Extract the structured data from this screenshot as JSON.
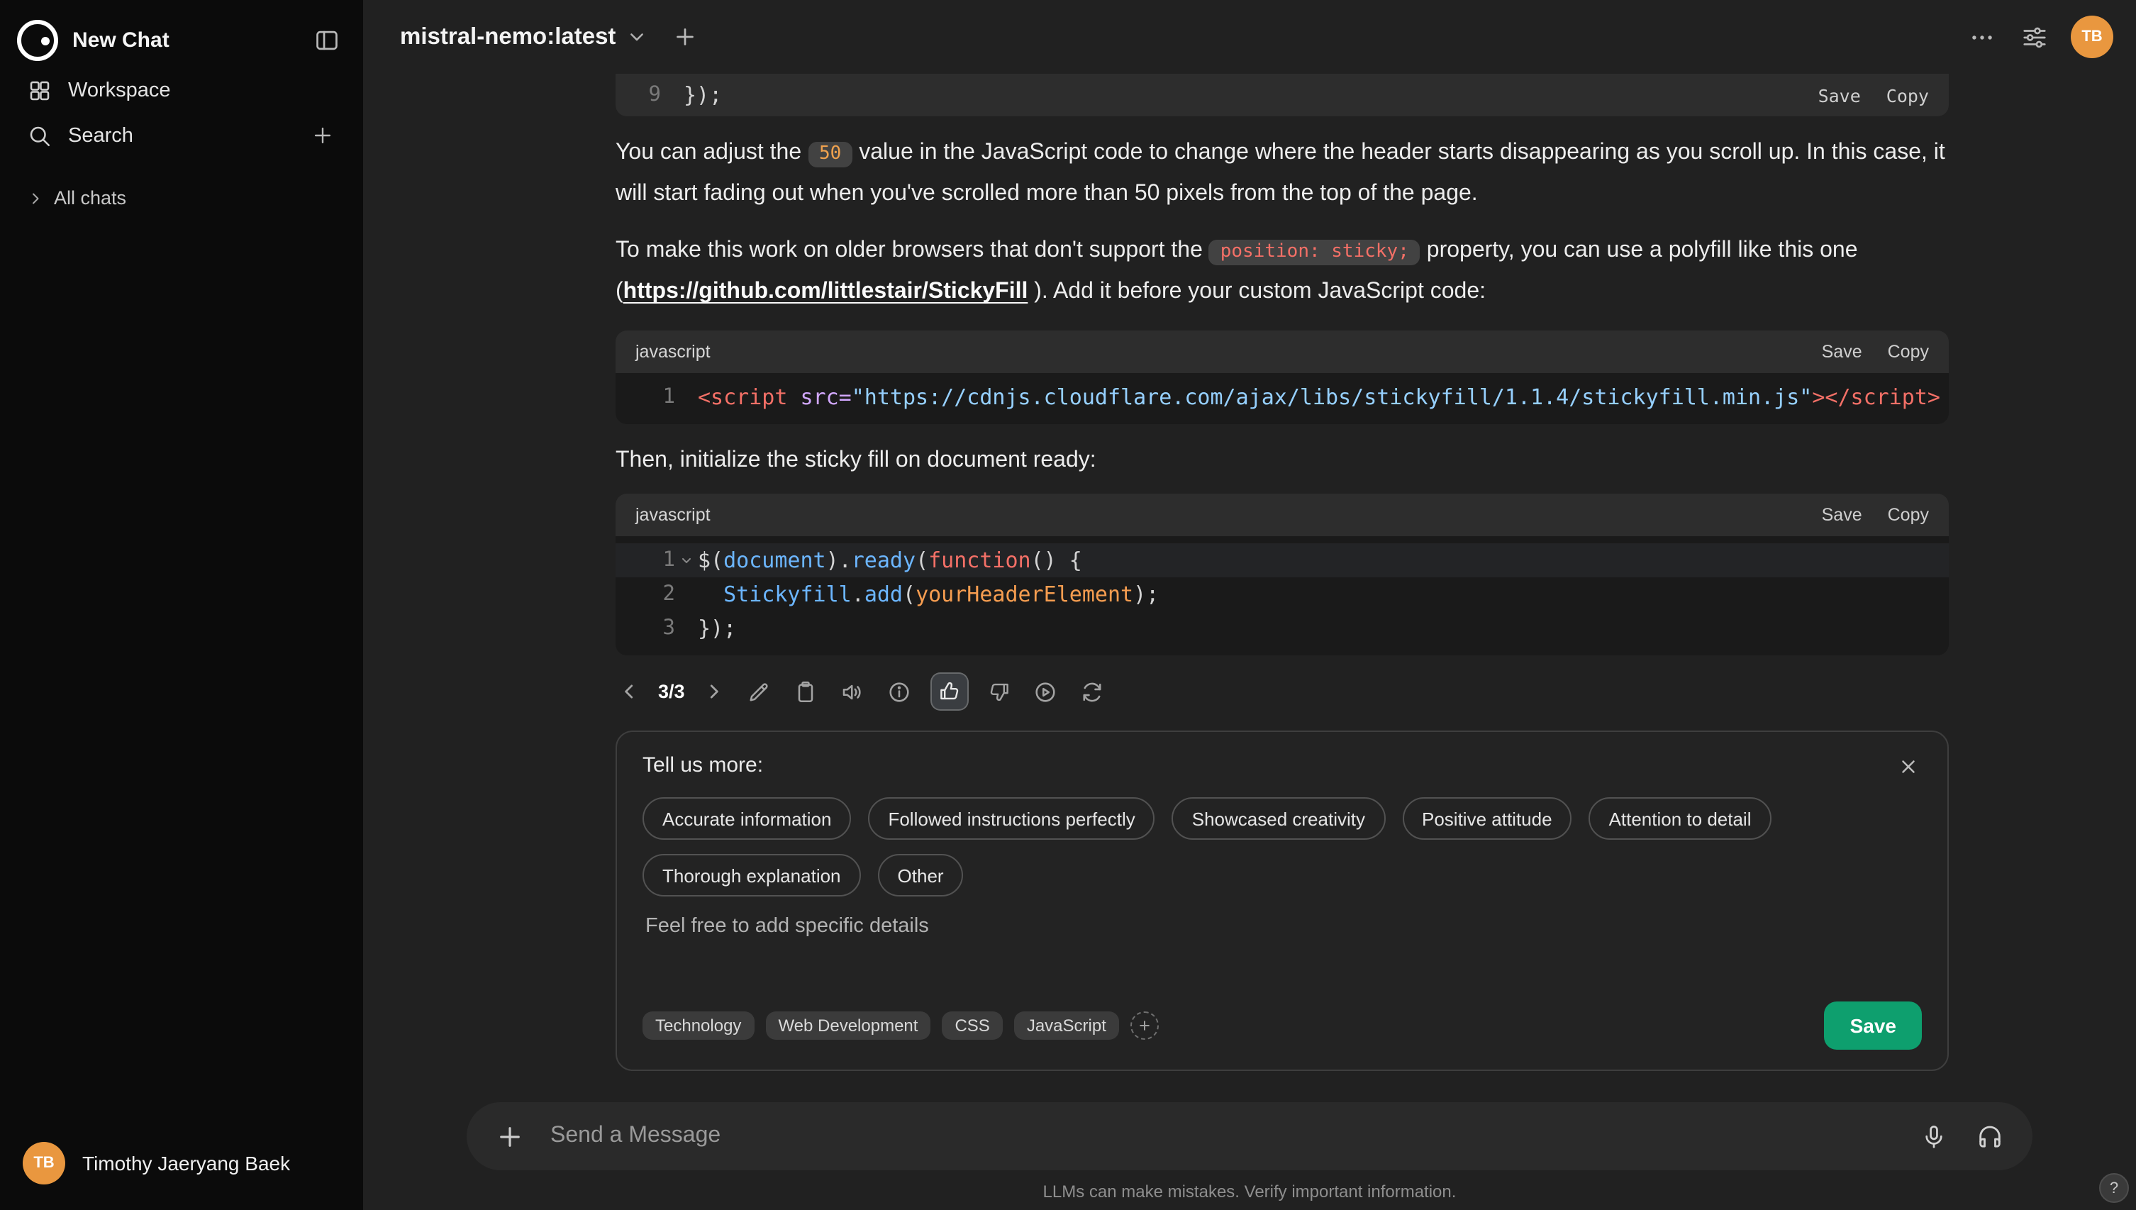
{
  "app": {
    "help_label": "?"
  },
  "colors": {
    "save_button_green": "#0e9f6e",
    "avatar_orange": "#e9973f",
    "sidebar_bg": "#0b0b0b",
    "main_bg": "#212121"
  },
  "sidebar": {
    "new_chat_label": "New Chat",
    "workspace_label": "Workspace",
    "search_label": "Search",
    "all_chats_label": "All chats",
    "user_name": "Timothy Jaeryang Baek",
    "user_initials": "TB"
  },
  "topbar": {
    "model_name": "mistral-nemo:latest",
    "avatar_initials": "TB"
  },
  "chat": {
    "prev_code": {
      "line_number": "9",
      "code": "});",
      "save_label": "Save",
      "copy_label": "Copy"
    },
    "para1": {
      "before": "You can adjust the ",
      "chip": "50",
      "after": " value in the JavaScript code to change where the header starts disappearing as you scroll up. In this case, it will start fading out when you've scrolled more than 50 pixels from the top of the page."
    },
    "para2": {
      "before": "To make this work on older browsers that don't support the ",
      "chip": "position: sticky;",
      "mid": " property, you can use a polyfill like this one (",
      "link": "https://github.com/littlestair/StickyFill",
      "after": " ). Add it before your custom JavaScript code:"
    },
    "code1": {
      "lang": "javascript",
      "save_label": "Save",
      "copy_label": "Copy",
      "line_number": "1",
      "t1": "<script",
      "t2": " ",
      "t3": "src=",
      "t4": "\"https://cdnjs.cloudflare.com/ajax/libs/stickyfill/1.1.4/stickyfill.min.js\"",
      "t5": "></script>"
    },
    "para3": "Then, initialize the sticky fill on document ready:",
    "code2": {
      "lang": "javascript",
      "save_label": "Save",
      "copy_label": "Copy",
      "l1n": "1",
      "l2n": "2",
      "l3n": "3",
      "l1t1": "$(",
      "l1t2": "document",
      "l1t3": ").",
      "l1t4": "ready",
      "l1t5": "(",
      "l1t6": "function",
      "l1t7": "() {",
      "l2t1": "  ",
      "l2t2": "Stickyfill",
      "l2t3": ".",
      "l2t4": "add",
      "l2t5": "(",
      "l2t6": "yourHeaderElement",
      "l2t7": ");",
      "l3t1": "});"
    },
    "nav": {
      "counter": "3/3"
    }
  },
  "feedback": {
    "title": "Tell us more:",
    "options": [
      "Accurate information",
      "Followed instructions perfectly",
      "Showcased creativity",
      "Positive attitude",
      "Attention to detail",
      "Thorough explanation",
      "Other"
    ],
    "details_placeholder": "Feel free to add specific details",
    "tags": [
      "Technology",
      "Web Development",
      "CSS",
      "JavaScript"
    ],
    "save_label": "Save"
  },
  "composer": {
    "placeholder": "Send a Message",
    "disclaimer": "LLMs can make mistakes. Verify important information."
  }
}
